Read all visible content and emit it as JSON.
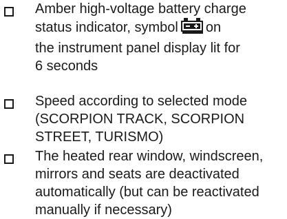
{
  "checklist": {
    "items": [
      {
        "lines": [
          "Amber high-voltage battery charge",
          "status indicator, symbol",
          "on",
          "the instrument panel display lit for",
          "6 seconds"
        ],
        "icon": "battery-charge-icon",
        "icon_color": "#1a1a1a"
      },
      {
        "lines": [
          "Speed according to selected mode",
          "(SCORPION TRACK, SCORPION",
          "STREET, TURISMO)"
        ]
      },
      {
        "lines": [
          "The heated rear window, windscreen,",
          "mirrors and seats are deactivated",
          "automatically (but can be reactivated",
          "manually if necessary)"
        ]
      }
    ]
  }
}
